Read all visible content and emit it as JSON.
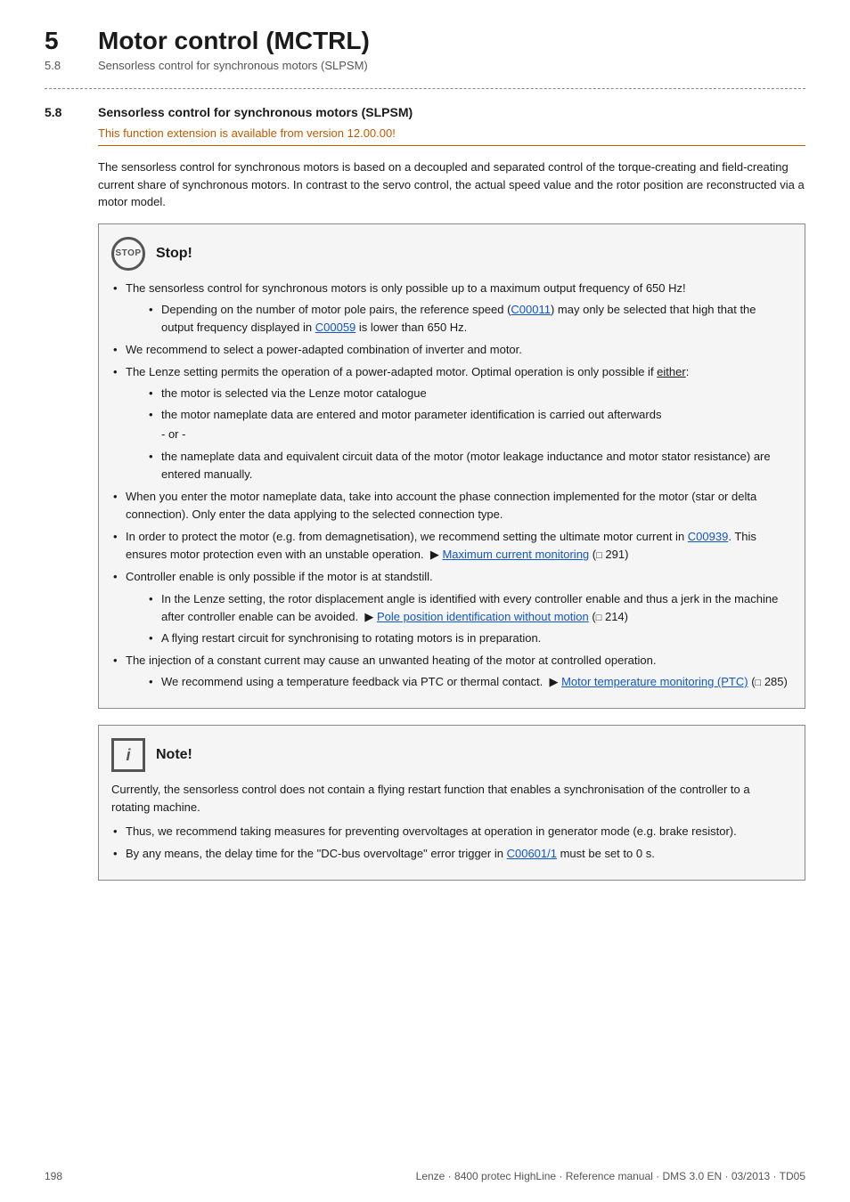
{
  "header": {
    "chapter_num": "5",
    "chapter_title": "Motor control (MCTRL)",
    "sub_num": "5.8",
    "sub_title": "Sensorless control for synchronous motors (SLPSM)"
  },
  "section": {
    "num": "5.8",
    "title": "Sensorless control for synchronous motors (SLPSM)",
    "version_note": "This function extension is available from version 12.00.00!"
  },
  "intro_text": "The sensorless control for synchronous motors is based on a decoupled and separated control of the torque-creating and field-creating current share of synchronous motors. In contrast to the servo control, the actual speed value and the rotor position are reconstructed via a motor model.",
  "stop_box": {
    "icon_text": "STOP",
    "title": "Stop!",
    "items": [
      {
        "text": "The sensorless control for synchronous motors is only possible up to a maximum output frequency of 650 Hz!",
        "sub_items": [
          {
            "text": "Depending on the number of motor pole pairs, the reference speed (",
            "link1_text": "C00011",
            "link1_href": "#C00011",
            "mid_text": ") may only be selected that high that the output frequency displayed in ",
            "link2_text": "C00059",
            "link2_href": "#C00059",
            "end_text": " is lower than 650 Hz."
          }
        ]
      },
      {
        "text": "We recommend to select a power-adapted combination of inverter and motor."
      },
      {
        "text": "The Lenze setting permits the operation of a power-adapted motor. Optimal operation is only possible if either:",
        "underline_word": "either",
        "sub_items": [
          {
            "text": "the motor is selected via the Lenze motor catalogue"
          },
          {
            "text": "the motor nameplate data are entered and motor parameter identification is carried out afterwards",
            "after_text": "- or -"
          },
          {
            "text": "the nameplate data and equivalent circuit data of the motor (motor leakage inductance and motor stator resistance) are entered manually."
          }
        ]
      },
      {
        "text": "When you enter the motor nameplate data, take into account the phase connection implemented for the motor (star or delta connection). Only enter the data applying to the selected connection type."
      },
      {
        "text": "In order to protect the motor (e.g. from demagnetisation), we recommend setting the ultimate motor current in ",
        "link1_text": "C00939",
        "link1_href": "#C00939",
        "mid_text": ". This ensures motor protection even with an unstable operation.  ▶ ",
        "link2_text": "Maximum current monitoring",
        "link2_href": "#MaxCurrentMonitoring",
        "end_text": " (⬛ 291)"
      },
      {
        "text": "Controller enable is only possible if the motor is at standstill.",
        "sub_items": [
          {
            "text": "In the Lenze setting, the rotor displacement angle is identified with every controller enable and thus a jerk in the machine after controller enable can be avoided.  ▶ ",
            "link_text": "Pole position identification without motion",
            "link_href": "#PolePosition",
            "end_text": " (⬛ 214)"
          },
          {
            "text": "A flying restart circuit for synchronising to rotating motors is in preparation."
          }
        ]
      },
      {
        "text": "The injection of a constant current may cause an unwanted heating of the motor at controlled operation.",
        "sub_items": [
          {
            "text": "We recommend using a temperature feedback via PTC or thermal contact.  ▶ ",
            "link_text": "Motor temperature monitoring (PTC)",
            "link_href": "#MotorTemp",
            "end_text": " (⬛ 285)"
          }
        ]
      }
    ]
  },
  "note_box": {
    "icon_text": "i",
    "title": "Note!",
    "intro": "Currently, the sensorless control does not contain a flying restart function that enables a synchronisation of the controller to a rotating machine.",
    "items": [
      "Thus, we recommend taking measures for preventing overvoltages at operation in generator mode (e.g. brake resistor).",
      {
        "text": "By any means, the delay time for the \"DC-bus overvoltage\" error trigger in ",
        "link_text": "C00601/1",
        "link_href": "#C00601",
        "end_text": " must be set to 0 s."
      }
    ]
  },
  "footer": {
    "page_num": "198",
    "publisher": "Lenze · 8400 protec HighLine · Reference manual · DMS 3.0 EN · 03/2013 · TD05"
  }
}
